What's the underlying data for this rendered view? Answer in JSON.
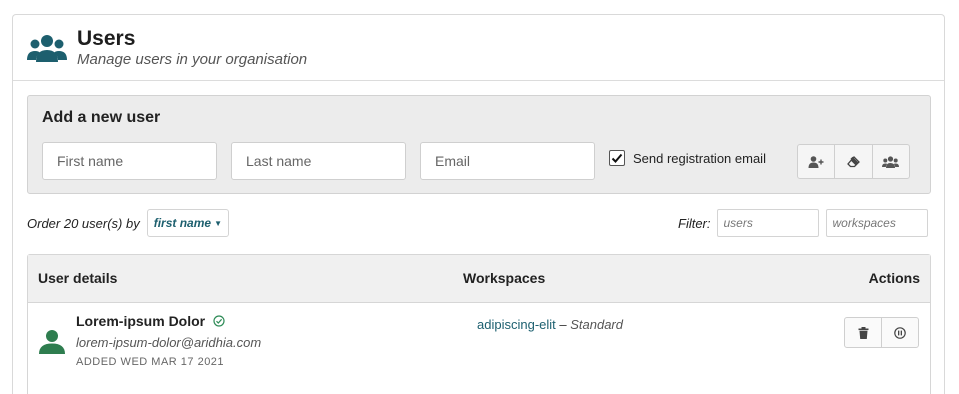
{
  "header": {
    "icon": "users-group-icon",
    "title": "Users",
    "subtitle": "Manage users in your organisation"
  },
  "add_user": {
    "title": "Add a new user",
    "first_name_placeholder": "First name",
    "last_name_placeholder": "Last name",
    "email_placeholder": "Email",
    "send_email_checked": true,
    "send_email_label": "Send registration email",
    "buttons": [
      {
        "icon": "add-user-icon"
      },
      {
        "icon": "eraser-icon"
      },
      {
        "icon": "users-group-icon"
      }
    ]
  },
  "ordering": {
    "prefix": "Order 20 user(s) by",
    "selected": "first name"
  },
  "filter": {
    "label": "Filter:",
    "users_placeholder": "users",
    "workspaces_placeholder": "workspaces"
  },
  "table": {
    "columns": [
      "User details",
      "Workspaces",
      "Actions"
    ],
    "rows": [
      {
        "name": "Lorem-ipsum Dolor",
        "email": "lorem-ipsum-dolor@aridhia.com",
        "added": "ADDED WED MAR 17 2021",
        "verified_icon": "check-circle-icon",
        "workspace": "adipiscing-elit",
        "workspace_separator": " – ",
        "workspace_role": "Standard",
        "actions": [
          {
            "icon": "trash-icon"
          },
          {
            "icon": "pause-icon"
          }
        ]
      }
    ]
  },
  "colors": {
    "accent": "#1d5f6e",
    "avatar_green": "#2e7d4f",
    "box_bg": "#ececec"
  }
}
